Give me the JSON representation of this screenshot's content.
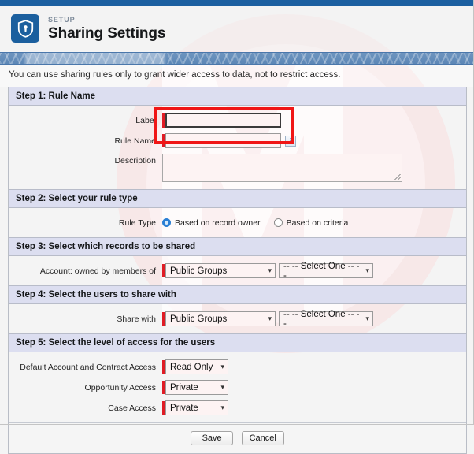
{
  "header": {
    "eyebrow": "SETUP",
    "title": "Sharing Settings",
    "icon": "shield-icon"
  },
  "notice": {
    "text": "You can use sharing rules only to grant wider access to data, not to restrict access."
  },
  "steps": [
    {
      "title": "Step 1: Rule Name",
      "fields": {
        "label_label": "Label",
        "label_value": "",
        "rule_name_label": "Rule Name",
        "rule_name_value": "",
        "info_icon": "info-icon",
        "info_glyph": "i",
        "description_label": "Description",
        "description_value": ""
      }
    },
    {
      "title": "Step 2: Select your rule type",
      "fields": {
        "rule_type_label": "Rule Type",
        "option_owner": "Based on record owner",
        "option_criteria": "Based on criteria",
        "selected": "Based on record owner"
      }
    },
    {
      "title": "Step 3: Select which records to be shared",
      "fields": {
        "owned_by_label": "Account: owned by members of",
        "source_value": "Public Groups",
        "target_value": "-- -- Select One -- --"
      }
    },
    {
      "title": "Step 4: Select the users to share with",
      "fields": {
        "share_with_label": "Share with",
        "source_value": "Public Groups",
        "target_value": "-- -- Select One -- --"
      }
    },
    {
      "title": "Step 5: Select the level of access for the users",
      "fields": {
        "default_access_label": "Default Account and Contract Access",
        "default_access_value": "Read Only",
        "opportunity_label": "Opportunity Access",
        "opportunity_value": "Private",
        "case_label": "Case Access",
        "case_value": "Private"
      }
    }
  ],
  "footer": {
    "save_label": "Save",
    "cancel_label": "Cancel"
  },
  "colors": {
    "brand_blue": "#1b5f9e",
    "top_strip": "#1c5fa0",
    "step_header_bg": "#dcdef0",
    "required_marker": "#e01b24",
    "annotation_red": "#f01616",
    "radio_selected": "#2a7fd4",
    "input_bg": "#fdf3f3"
  },
  "icons": {
    "caret_down": "⌄"
  }
}
